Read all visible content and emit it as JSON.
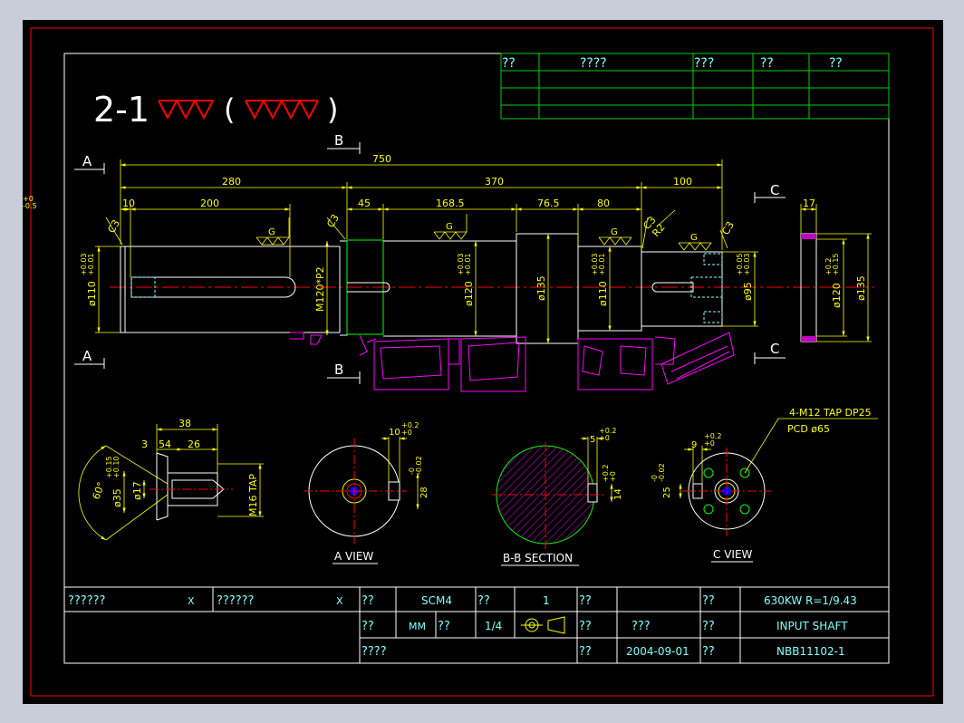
{
  "drawing": {
    "heading_prefix": "2-1",
    "heading_open": "(",
    "heading_close": ")",
    "section_marks": {
      "a": "A",
      "b": "B",
      "c": "C"
    },
    "dims": {
      "total_len": "750",
      "len_280": "280",
      "len_370": "370",
      "len_100": "100",
      "len_10": "10",
      "len_200": "200",
      "len_45": "45",
      "len_168": "168.5",
      "len_76": "76.5",
      "len_80": "80",
      "tol_80": "+0\n-0.5",
      "len_17": "17"
    },
    "chamfers": {
      "c3_left": "C3",
      "c3_mid": "C3",
      "c3_right_a": "C3",
      "c3_right_b": "C3",
      "r2": "R2"
    },
    "grind_mark": "G",
    "diameters": {
      "d110": "ø110",
      "d110_tol": "+0.03\n+0.01",
      "m120": "M120*P2",
      "d120": "ø120",
      "d120_tol": "+0.03\n+0.01",
      "d135": "ø135",
      "d110b": "ø110",
      "d110b_tol": "+0.03\n+0.01",
      "d95": "ø95",
      "d95_tol": "+0.05\n+0.03",
      "d120c": "ø120",
      "d120c_tol": "+0.2\n+0.15",
      "d135c": "ø135"
    },
    "detail_center": {
      "len_38": "38",
      "len_3": "3",
      "len_54": "54",
      "len_26": "26",
      "angle_60": "60°",
      "d35": "ø35",
      "d35_tol": "+0.15\n+0.10",
      "d17": "ø17",
      "m16": "M16 TAP"
    },
    "a_view": {
      "label": "A VIEW",
      "w10": "10",
      "w10_tol": "+0.2\n+0",
      "h28": "28",
      "h28_tol": "-0\n-0.02"
    },
    "bb_section": {
      "label": "B-B SECTION",
      "w5": "5",
      "w5_tol": "+0.2\n+0",
      "h14": "14",
      "h14_tol": "+0.2\n+0"
    },
    "c_view": {
      "label": "C VIEW",
      "w9": "9",
      "w9_tol": "+0.2\n+0",
      "h25": "25",
      "h25_tol": "-0\n-0.02",
      "tap_note": "4-M12 TAP DP25",
      "pcd_note": "PCD ø65"
    }
  },
  "revision_table": {
    "headers": [
      "??",
      "????",
      "???",
      "??",
      "??"
    ]
  },
  "title_block": {
    "row1": {
      "c1": "??????",
      "x1": "X",
      "c2": "??????",
      "x2": "X",
      "material_label": "??",
      "material": "SCM4",
      "qty_label": "??",
      "qty": "1",
      "l3": "??",
      "l4": "??",
      "spec": "630KW R=1/9.43"
    },
    "row2": {
      "unit_label": "??",
      "unit": "MM",
      "scale_label": "??",
      "scale": "1/4",
      "l3": "??",
      "drafter": "???",
      "l4": "??",
      "name": "INPUT SHAFT"
    },
    "row3": {
      "c1": "????",
      "l3": "??",
      "date": "2004-09-01",
      "l4": "??",
      "drawing_no": "NBB11102-1"
    }
  },
  "colors": {
    "frame_red": "#d40000",
    "line_white": "#ffffff",
    "dim_yellow": "#ffff00",
    "table_green": "#00d000",
    "bearing_magenta": "#ff00ff",
    "center_red": "#ff0000",
    "hatch_magenta": "#c000c0",
    "hole_blue": "#0000ff",
    "face_green": "#00ff00",
    "text_cyan": "#80ffff"
  }
}
